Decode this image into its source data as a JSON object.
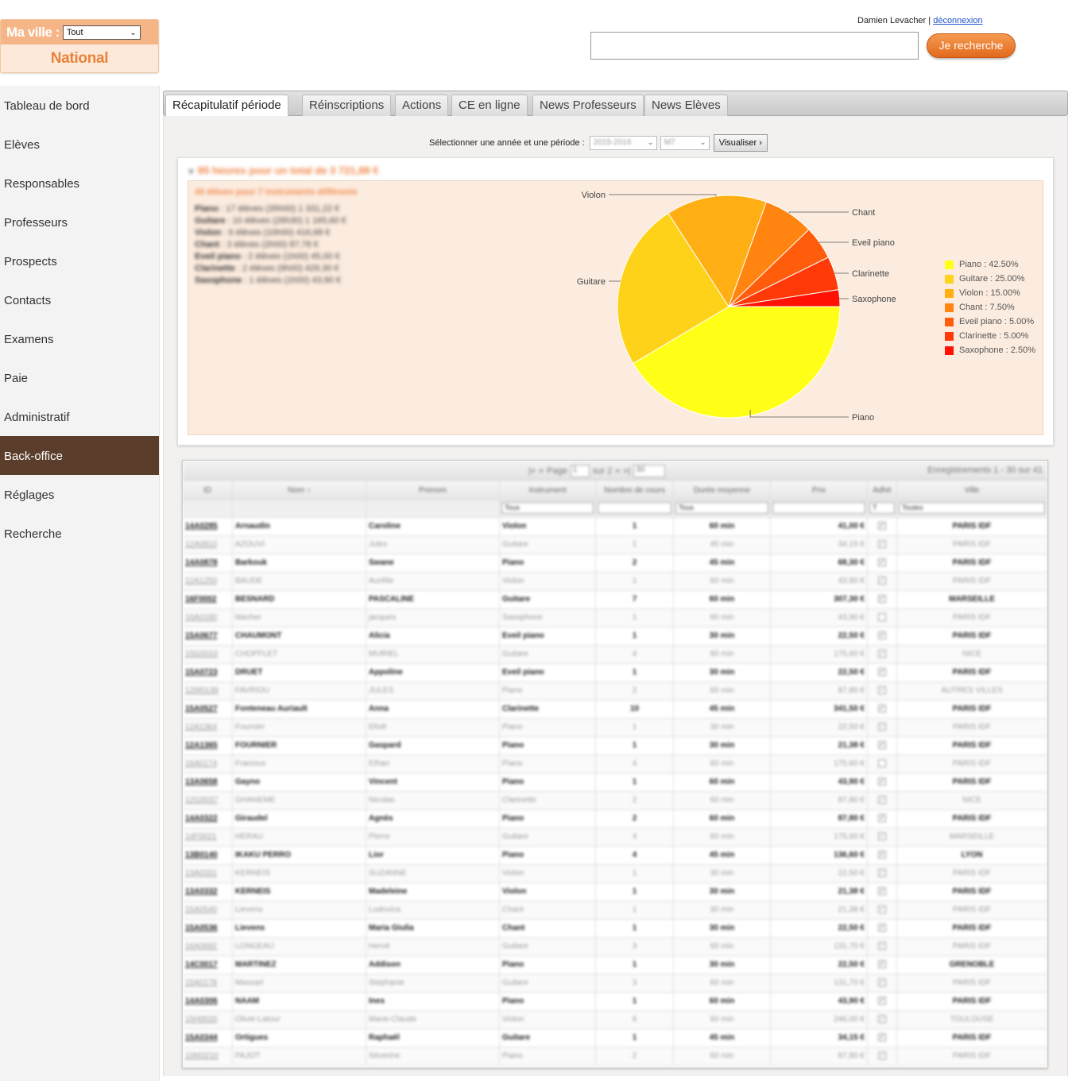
{
  "city": {
    "label": "Ma ville :",
    "selected": "Tout",
    "scope": "National"
  },
  "nav": [
    {
      "label": "Tableau de bord",
      "name": "nav-tableau-de-bord"
    },
    {
      "label": "Elèves",
      "name": "nav-eleves"
    },
    {
      "label": "Responsables",
      "name": "nav-responsables"
    },
    {
      "label": "Professeurs",
      "name": "nav-professeurs"
    },
    {
      "label": "Prospects",
      "name": "nav-prospects"
    },
    {
      "label": "Contacts",
      "name": "nav-contacts"
    },
    {
      "label": "Examens",
      "name": "nav-examens"
    },
    {
      "label": "Paie",
      "name": "nav-paie"
    },
    {
      "label": "Administratif",
      "name": "nav-administratif"
    },
    {
      "label": "Back-office",
      "name": "nav-back-office",
      "active": true
    },
    {
      "label": "Réglages",
      "name": "nav-reglages"
    },
    {
      "label": "Recherche",
      "name": "nav-recherche"
    }
  ],
  "header": {
    "user_name": "Damien Levacher",
    "separator": "|",
    "logout": "déconnexion",
    "search_button": "Je recherche",
    "search_value": ""
  },
  "tabs": [
    {
      "label": "Récapitulatif période",
      "active": true
    },
    {
      "label": "Réinscriptions"
    },
    {
      "label": "Actions"
    },
    {
      "label": "CE en ligne"
    },
    {
      "label": "News Professeurs"
    },
    {
      "label": "News Elèves"
    }
  ],
  "period": {
    "prompt": "Sélectionner une année et une période :",
    "year": "2015-2016",
    "period": "M7",
    "button": "Visualiser ›"
  },
  "recap": {
    "title": "85 heures pour un total de 3 721,88 €",
    "subtitle": "40 élèves pour 7 instruments différents",
    "lines": [
      {
        "instrument": "Piano",
        "detail": " : 17 élèves (35h00) 1 331,22 €"
      },
      {
        "instrument": "Guitare",
        "detail": " : 10 élèves (26h30) 1 165,60 €"
      },
      {
        "instrument": "Violon",
        "detail": " : 6 élèves (10h00) 416,68 €"
      },
      {
        "instrument": "Chant",
        "detail": " : 3 élèves (2h00) 87,78 €"
      },
      {
        "instrument": "Eveil piano",
        "detail": " : 2 élèves (1h00) 45,00 €"
      },
      {
        "instrument": "Clarinette",
        "detail": " : 2 élèves (9h00) 429,30 €"
      },
      {
        "instrument": "Saxophone",
        "detail": " : 1 élèves (1h00) 43,90 €"
      }
    ]
  },
  "chart_data": {
    "type": "pie",
    "categories": [
      "Piano",
      "Guitare",
      "Violon",
      "Chant",
      "Eveil piano",
      "Clarinette",
      "Saxophone"
    ],
    "values": [
      42.5,
      25.0,
      15.0,
      7.5,
      5.0,
      5.0,
      2.5
    ],
    "legend": [
      "Piano : 42.50%",
      "Guitare : 25.00%",
      "Violon : 15.00%",
      "Chant : 7.50%",
      "Eveil piano : 5.00%",
      "Clarinette : 5.00%",
      "Saxophone : 2.50%"
    ],
    "colors": [
      "#ffff18",
      "#ffd21a",
      "#ffaf14",
      "#ff8410",
      "#ff5c0c",
      "#ff3a08",
      "#ff1204"
    ],
    "legend_position": "right"
  },
  "grid": {
    "pager": {
      "page_label": "Page",
      "page": "1",
      "of": "sur 2",
      "per_page": "30",
      "records": "Enregistrements 1 - 30 sur 41"
    },
    "columns": [
      "ID",
      "Nom ↑",
      "Prenom",
      "Instrument",
      "Nombre de cours",
      "Durée moyenne",
      "Prix",
      "Adhé",
      "Ville"
    ],
    "filters": [
      "",
      "",
      "",
      "Tous",
      "",
      "Tous",
      "",
      "T",
      "Toutes"
    ],
    "rows": [
      [
        "14A0285",
        "Arnaudin",
        "Caroline",
        "Violon",
        "1",
        "60 min",
        "41,00 €",
        "1",
        "PARIS IDF"
      ],
      [
        "12A0810",
        "AZOUVI",
        "Jules",
        "Guitare",
        "1",
        "45 min",
        "34,15 €",
        "1",
        "PARIS IDF"
      ],
      [
        "14A0878",
        "Barkouk",
        "Swane",
        "Piano",
        "2",
        "45 min",
        "68,30 €",
        "1",
        "PARIS IDF"
      ],
      [
        "12A1250",
        "BAUDE",
        "Aurélie",
        "Violon",
        "1",
        "60 min",
        "43,90 €",
        "1",
        "PARIS IDF"
      ],
      [
        "16F0002",
        "BESNARD",
        "PASCALINE",
        "Guitare",
        "7",
        "60 min",
        "307,30 €",
        "1",
        "MARSEILLE"
      ],
      [
        "16A0190",
        "blacher",
        "jacques",
        "Saxophone",
        "1",
        "60 min",
        "43,90 €",
        "0",
        "PARIS IDF"
      ],
      [
        "15A0677",
        "CHAUMONT",
        "Alicia",
        "Eveil piano",
        "1",
        "30 min",
        "22,50 €",
        "1",
        "PARIS IDF"
      ],
      [
        "15G0010",
        "CHOPFLET",
        "MURIEL",
        "Guitare",
        "4",
        "60 min",
        "175,60 €",
        "1",
        "NICE"
      ],
      [
        "15A0723",
        "DRUET",
        "Appoline",
        "Eveil piano",
        "1",
        "30 min",
        "22,50 €",
        "1",
        "PARIS IDF"
      ],
      [
        "12M0139",
        "FAVRIOU",
        "JULES",
        "Piano",
        "2",
        "60 min",
        "87,80 €",
        "1",
        "AUTRES VILLES"
      ],
      [
        "15A0527",
        "Fonteneau Auriault",
        "Anna",
        "Clarinette",
        "10",
        "45 min",
        "341,50 €",
        "1",
        "PARIS IDF"
      ],
      [
        "12A1364",
        "Fournier",
        "Eliott",
        "Piano",
        "1",
        "30 min",
        "22,50 €",
        "1",
        "PARIS IDF"
      ],
      [
        "12A1365",
        "FOURNIER",
        "Gaspard",
        "Piano",
        "1",
        "30 min",
        "21,38 €",
        "1",
        "PARIS IDF"
      ],
      [
        "16A0174",
        "Francius",
        "Ethan",
        "Piano",
        "4",
        "60 min",
        "175,60 €",
        "0",
        "PARIS IDF"
      ],
      [
        "13A0658",
        "Gayno",
        "Vincent",
        "Piano",
        "1",
        "60 min",
        "43,90 €",
        "1",
        "PARIS IDF"
      ],
      [
        "12G0037",
        "GHANEME",
        "Nicolas",
        "Clarinette",
        "2",
        "60 min",
        "87,80 €",
        "1",
        "NICE"
      ],
      [
        "14A0322",
        "Giraudel",
        "Agnès",
        "Piano",
        "2",
        "60 min",
        "87,80 €",
        "1",
        "PARIS IDF"
      ],
      [
        "14F0021",
        "HERAU",
        "Pierre",
        "Guitare",
        "4",
        "60 min",
        "175,60 €",
        "1",
        "MARSEILLE"
      ],
      [
        "13B0140",
        "IKAKU PERRO",
        "Lior",
        "Piano",
        "4",
        "45 min",
        "136,60 €",
        "1",
        "LYON"
      ],
      [
        "13A0331",
        "KERNEIS",
        "SUZANNE",
        "Violon",
        "1",
        "30 min",
        "22,50 €",
        "1",
        "PARIS IDF"
      ],
      [
        "13A0332",
        "KERNEIS",
        "Madeleine",
        "Violon",
        "1",
        "30 min",
        "21,38 €",
        "1",
        "PARIS IDF"
      ],
      [
        "15A0540",
        "Lievens",
        "Ludovica",
        "Chant",
        "1",
        "30 min",
        "21,38 €",
        "1",
        "PARIS IDF"
      ],
      [
        "15A0536",
        "Lievens",
        "Maria Giulia",
        "Chant",
        "1",
        "30 min",
        "22,50 €",
        "1",
        "PARIS IDF"
      ],
      [
        "16A0692",
        "LONGEAU",
        "Hervé",
        "Guitare",
        "3",
        "60 min",
        "131,70 €",
        "1",
        "PARIS IDF"
      ],
      [
        "14C0017",
        "MARTINEZ",
        "Addison",
        "Piano",
        "1",
        "30 min",
        "22,50 €",
        "1",
        "GRENOBLE"
      ],
      [
        "15A0178",
        "Massart",
        "Stephanie",
        "Guitare",
        "3",
        "60 min",
        "131,70 €",
        "1",
        "PARIS IDF"
      ],
      [
        "14A0306",
        "NAAM",
        "Ines",
        "Piano",
        "1",
        "60 min",
        "43,90 €",
        "1",
        "PARIS IDF"
      ],
      [
        "15H0020",
        "Olivié-Latour",
        "Marie-Claude",
        "Violon",
        "6",
        "60 min",
        "246,00 €",
        "1",
        "TOULOUSE"
      ],
      [
        "15A0344",
        "Ortigues",
        "Raphaël",
        "Guitare",
        "1",
        "45 min",
        "34,15 €",
        "1",
        "PARIS IDF"
      ],
      [
        "10M3210",
        "PAJOT",
        "Séverine",
        "Piano",
        "2",
        "60 min",
        "87,80 €",
        "1",
        "PARIS IDF"
      ]
    ]
  }
}
